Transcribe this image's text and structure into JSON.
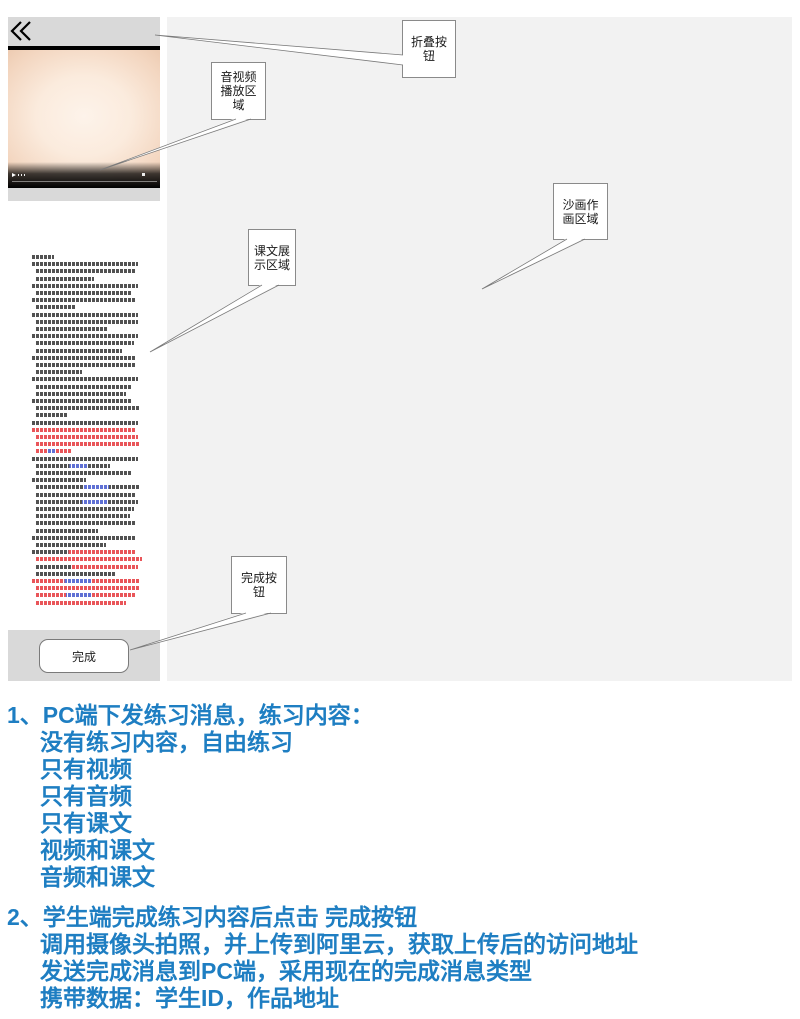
{
  "sidebar": {
    "collapse_icon": "double-chevron-left-icon",
    "complete_button_label": "完成"
  },
  "callouts": {
    "collapse_button": "折叠按钮",
    "media_player_area": "音视频播放区域",
    "lesson_text_area": "课文展示区域",
    "sand_painting_area": "沙画作画区域",
    "complete_button": "完成按钮"
  },
  "notes": {
    "section_1": {
      "heading": "1、PC端下发练习消息，练习内容：",
      "items": [
        "没有练习内容，自由练习",
        "只有视频",
        "只有音频",
        "只有课文",
        "视频和课文",
        "音频和课文"
      ]
    },
    "section_2": {
      "heading": "2、学生端完成练习内容后点击 完成按钮",
      "items": [
        "调用摄像头拍照，并上传到阿里云，获取上传后的访问地址",
        "发送完成消息到PC端，采用现在的完成消息类型",
        "携带数据：学生ID，作品地址"
      ]
    }
  },
  "colors": {
    "note_text": "#1e7ec2",
    "panel_gray": "#d9d9d9",
    "canvas_background": "#f2f2f2",
    "lesson_text_black": "#222222",
    "lesson_text_red": "#e3262b",
    "lesson_text_blue": "#3348c8"
  }
}
